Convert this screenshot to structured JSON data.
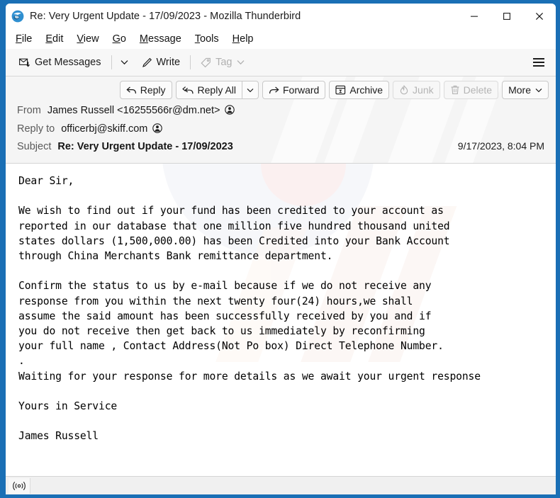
{
  "window": {
    "title": "Re: Very Urgent Update - 17/09/2023 - Mozilla Thunderbird",
    "app_logo_icon": "thunderbird-logo-icon",
    "border_color": "#1a6fb5",
    "controls": {
      "minimize": "minimize-icon",
      "maximize": "maximize-icon",
      "close": "close-icon"
    }
  },
  "menubar": {
    "items": [
      {
        "label": "File",
        "accesskey": "F"
      },
      {
        "label": "Edit",
        "accesskey": "E"
      },
      {
        "label": "View",
        "accesskey": "V"
      },
      {
        "label": "Go",
        "accesskey": "G"
      },
      {
        "label": "Message",
        "accesskey": "M"
      },
      {
        "label": "Tools",
        "accesskey": "T"
      },
      {
        "label": "Help",
        "accesskey": "H"
      }
    ]
  },
  "toolbar": {
    "get_messages_label": "Get Messages",
    "get_messages_icon": "envelope-download-icon",
    "get_messages_caret_icon": "chevron-down-icon",
    "write_label": "Write",
    "write_icon": "pencil-icon",
    "tag_label": "Tag",
    "tag_icon": "tag-icon",
    "tag_caret_icon": "chevron-down-icon",
    "tag_disabled": true,
    "menu_icon": "hamburger-menu-icon"
  },
  "actions": {
    "reply_label": "Reply",
    "reply_icon": "reply-arrow-icon",
    "reply_all_label": "Reply All",
    "reply_all_icon": "reply-all-arrow-icon",
    "reply_all_caret_icon": "chevron-down-icon",
    "forward_label": "Forward",
    "forward_icon": "forward-arrow-icon",
    "archive_label": "Archive",
    "archive_icon": "archive-box-icon",
    "junk_label": "Junk",
    "junk_icon": "flame-icon",
    "junk_disabled": true,
    "delete_label": "Delete",
    "delete_icon": "trash-icon",
    "delete_disabled": true,
    "more_label": "More",
    "more_caret_icon": "chevron-down-icon"
  },
  "message_header": {
    "from_label": "From",
    "from_value": "James Russell <16255566r@dm.net>",
    "from_contact_icon": "contact-person-icon",
    "reply_to_label": "Reply to",
    "reply_to_value": "officerbj@skiff.com",
    "reply_to_contact_icon": "contact-person-icon",
    "subject_label": "Subject",
    "subject_value": "Re: Very Urgent Update - 17/09/2023",
    "date": "9/17/2023, 8:04 PM"
  },
  "message_body": {
    "text": "Dear Sir,\n\nWe wish to find out if your fund has been credited to your account as\nreported in our database that one million five hundred thousand united\nstates dollars (1,500,000.00) has been Credited into your Bank Account\nthrough China Merchants Bank remittance department.\n\nConfirm the status to us by e-mail because if we do not receive any\nresponse from you within the next twenty four(24) hours,we shall\nassume the said amount has been successfully received by you and if\nyou do not receive then get back to us immediately by reconfirming\nyour full name , Contact Address(Not Po box) Direct Telephone Number.\n.\nWaiting for your response for more details as we await your urgent response\n\nYours in Service\n\nJames Russell"
  },
  "statusbar": {
    "online_icon": "broadcast-online-icon",
    "text": ""
  }
}
